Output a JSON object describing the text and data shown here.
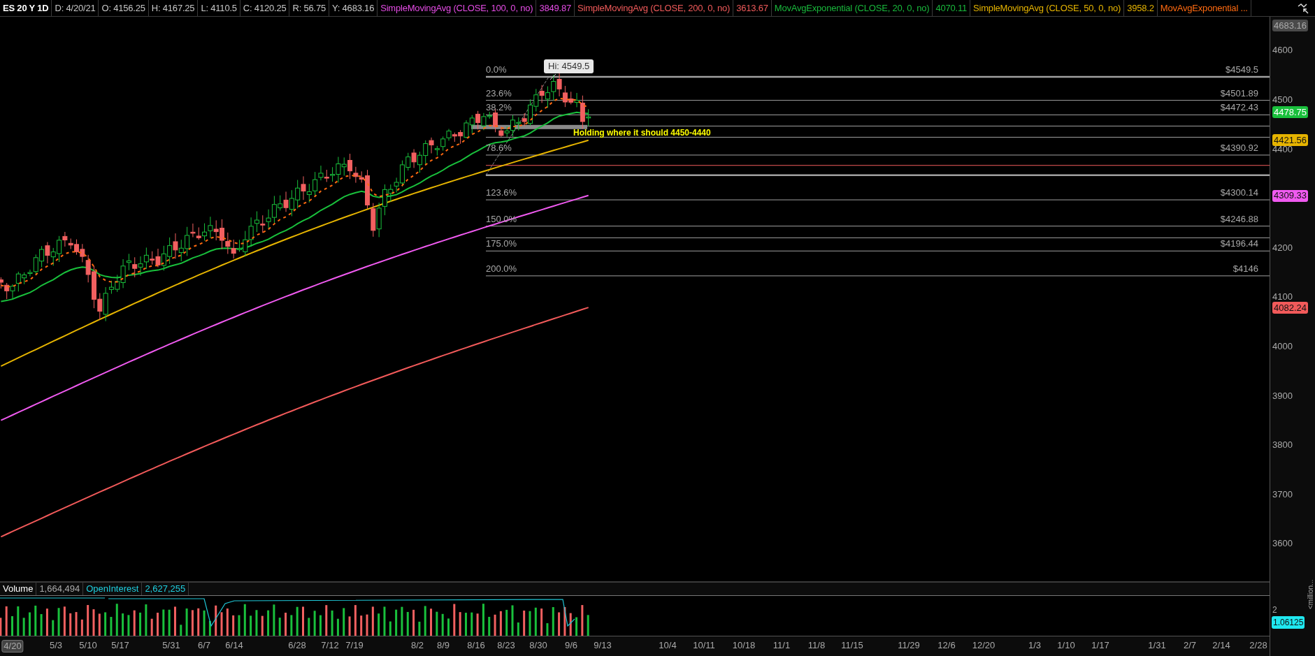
{
  "header": {
    "symbol": "ES 20 Y 1D",
    "fields": [
      "D: 4/20/21",
      "O: 4156.25",
      "H: 4167.25",
      "L: 4110.5",
      "C: 4120.25",
      "R: 56.75",
      "Y: 4683.16"
    ],
    "studies": [
      {
        "label": "SimpleMovingAvg (CLOSE, 100, 0, no)",
        "value": "3849.87",
        "color": "#e64ce6"
      },
      {
        "label": "SimpleMovingAvg (CLOSE, 200, 0, no)",
        "value": "3613.67",
        "color": "#f05a5a"
      },
      {
        "label": "MovAvgExponential (CLOSE, 20, 0, no)",
        "value": "4070.11",
        "color": "#19b93c"
      },
      {
        "label": "SimpleMovingAvg (CLOSE, 50, 0, no)",
        "value": "3958.2",
        "color": "#e6b400"
      },
      {
        "label": "MovAvgExponential ...",
        "color": "#ff6a10"
      }
    ]
  },
  "chart": {
    "high_callout": "Hi: 4549.5",
    "note": "Holding where it should 4450-4440",
    "fib_levels": [
      {
        "percent": "0.0%",
        "price": "$4549.5"
      },
      {
        "percent": "23.6%",
        "price": "$4501.89"
      },
      {
        "percent": "38.2%",
        "price": "$4472.43"
      },
      {
        "percent": "78.6%",
        "price": "$4390.92"
      },
      {
        "percent": "123.6%",
        "price": "$4300.14"
      },
      {
        "percent": "150.0%",
        "price": "$4246.88"
      },
      {
        "percent": "175.0%",
        "price": "$4196.44"
      },
      {
        "percent": "200.0%",
        "price": "$4146"
      }
    ]
  },
  "price_axis": {
    "ticks": [
      "4600",
      "4500",
      "4400",
      "4200",
      "4100",
      "4000",
      "3900",
      "3800",
      "3700",
      "3600"
    ],
    "tags": [
      {
        "text": "4683.16",
        "color": "#4a4a4a"
      },
      {
        "text": "4478.75",
        "color": "#19c03c"
      },
      {
        "text": "4421.56",
        "color": "#e6b400"
      },
      {
        "text": "4309.33",
        "color": "#f05af0"
      },
      {
        "text": "4082.24",
        "color": "#f25a5a"
      }
    ]
  },
  "volume": {
    "label": "Volume",
    "value": "1,664,494",
    "oi_label": "OpenInterest",
    "oi_value": "2,627,255",
    "axis_tick": "2",
    "tag": "1.06125",
    "unit": "<million..."
  },
  "date_axis": [
    "4/20",
    "5/3",
    "5/10",
    "5/17",
    "5/31",
    "6/7",
    "6/14",
    "6/28",
    "7/12",
    "7/19",
    "8/2",
    "8/9",
    "8/16",
    "8/23",
    "8/30",
    "9/6",
    "9/13",
    "10/4",
    "10/11",
    "10/18",
    "11/1",
    "11/8",
    "11/15",
    "11/29",
    "12/6",
    "12/20",
    "1/3",
    "1/10",
    "1/17",
    "1/31",
    "2/7",
    "2/14",
    "2/28"
  ]
}
